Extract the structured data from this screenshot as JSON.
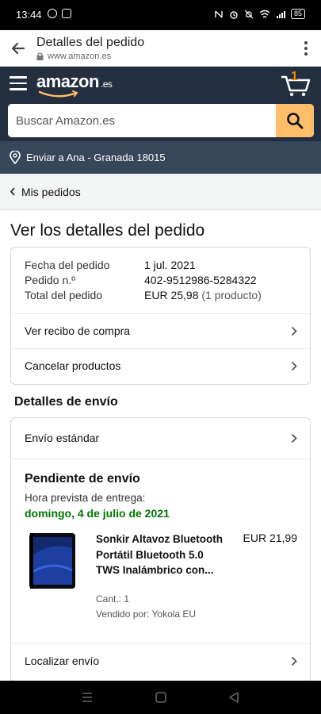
{
  "statusbar": {
    "time": "13:44",
    "battery": "85"
  },
  "browser": {
    "title": "Detalles del pedido",
    "url": "www.amazon.es"
  },
  "header": {
    "logo": "amazon",
    "logo_tld": ".es",
    "cart_count": "1"
  },
  "search": {
    "placeholder": "Buscar Amazon.es"
  },
  "deliver": {
    "text": "Enviar a Ana - Granada 18015"
  },
  "breadcrumb": {
    "label": "Mis pedidos"
  },
  "page": {
    "title": "Ver los detalles del pedido"
  },
  "summary": {
    "date_label": "Fecha del pedido",
    "date_value": "1 jul. 2021",
    "order_label": "Pedido n.º",
    "order_value": "402-9512986-5284322",
    "total_label": "Total del pedido",
    "total_value": "EUR 25,98",
    "total_count": "(1 producto)"
  },
  "actions": {
    "receipt": "Ver recibo de compra",
    "cancel": "Cancelar productos"
  },
  "shipping": {
    "heading": "Detalles de envío",
    "method": "Envío estándar",
    "status": "Pendiente de envío",
    "eta_label": "Hora prevista de entrega:",
    "eta_date": "domingo, 4 de julio de 2021",
    "track": "Localizar envío"
  },
  "product": {
    "title": "Sonkir Altavoz Bluetooth Portátil Bluetooth 5.0 TWS Inalámbrico con...",
    "price": "EUR 21,99",
    "qty": "Cant.: 1",
    "seller": "Vendido por: Yokola EU"
  },
  "colors": {
    "amazon_dark": "#232f3e",
    "deliver_bar": "#37475a",
    "search_btn": "#febd69",
    "eta_green": "#007600",
    "cart_orange": "#f08804"
  }
}
